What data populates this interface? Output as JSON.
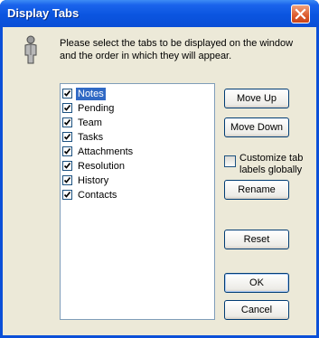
{
  "window": {
    "title": "Display Tabs"
  },
  "icons": {
    "close": "close-icon",
    "user": "person-icon",
    "check": "checkmark-icon"
  },
  "colors": {
    "titlebar": "#0b55e0",
    "selection": "#316ac5",
    "close": "#dc5a2c",
    "client": "#ece9d8"
  },
  "dialog": {
    "instructions": "Please select the tabs to be displayed on the window and the order in which they will appear."
  },
  "tabs": [
    {
      "label": "Notes",
      "checked": true,
      "selected": true
    },
    {
      "label": "Pending",
      "checked": true,
      "selected": false
    },
    {
      "label": "Team",
      "checked": true,
      "selected": false
    },
    {
      "label": "Tasks",
      "checked": true,
      "selected": false
    },
    {
      "label": "Attachments",
      "checked": true,
      "selected": false
    },
    {
      "label": "Resolution",
      "checked": true,
      "selected": false
    },
    {
      "label": "History",
      "checked": true,
      "selected": false
    },
    {
      "label": "Contacts",
      "checked": true,
      "selected": false
    }
  ],
  "buttons": {
    "move_up": "Move Up",
    "move_down": "Move Down",
    "rename": "Rename",
    "reset": "Reset",
    "ok": "OK",
    "cancel": "Cancel"
  },
  "customize": {
    "label": "Customize tab labels globally",
    "checked": false
  }
}
